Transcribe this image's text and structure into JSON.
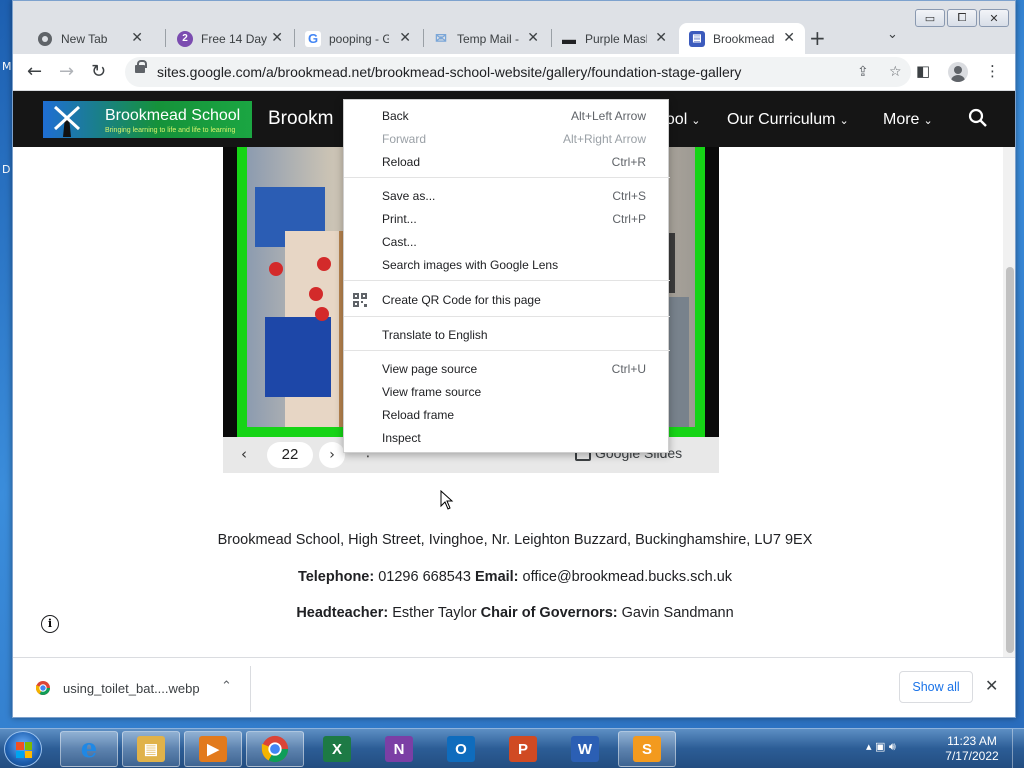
{
  "desktop": {
    "glyphs": [
      "M",
      "D"
    ]
  },
  "window": {
    "controls": [
      "▭",
      "⧠",
      "✕"
    ]
  },
  "tabs": [
    {
      "label": "New Tab",
      "icon": "chrome-icon",
      "color": "#5f6368",
      "glyph": ""
    },
    {
      "label": "Free 14 Day",
      "icon": "numeric-two-icon",
      "color": "#7b4cb0",
      "glyph": "2"
    },
    {
      "label": "pooping - Go",
      "icon": "google-icon",
      "color": "#4285f4",
      "glyph": "G"
    },
    {
      "label": "Temp Mail -",
      "icon": "mail-icon",
      "color": "#7aa6d8",
      "glyph": "✉"
    },
    {
      "label": "Purple Mash",
      "icon": "purple-mash-icon",
      "color": "#202124",
      "glyph": "▬"
    },
    {
      "label": "Brookmead",
      "icon": "google-sites-icon",
      "color": "#3c5bbd",
      "glyph": "▤"
    }
  ],
  "toolbar": {
    "url": "sites.google.com/a/brookmead.net/brookmead-school-website/gallery/foundation-stage-gallery"
  },
  "site": {
    "logo_name": "Brookmead School",
    "logo_tagline": "Bringing learning to life and life to learning",
    "title": "Brookm",
    "nav": [
      "hool",
      "Our Curriculum",
      "More"
    ]
  },
  "embed": {
    "page_number": "22",
    "slides_label": "Google Slides"
  },
  "footer": {
    "address": "Brookmead School, High Street, Ivinghoe, Nr. Leighton Buzzard, Buckinghamshire, LU7 9EX",
    "telephone_label": "Telephone:",
    "telephone": " 01296 668543  ",
    "email_label": "Email:",
    "email": " office@brookmead.bucks.sch.uk",
    "head_label": "Headteacher:",
    "head": " Esther Taylor  ",
    "chair_label": "Chair of Governors:",
    "chair": " Gavin Sandmann"
  },
  "context_menu": {
    "items": [
      {
        "label": "Back",
        "shortcut": "Alt+Left Arrow",
        "disabled": false
      },
      {
        "label": "Forward",
        "shortcut": "Alt+Right Arrow",
        "disabled": true
      },
      {
        "label": "Reload",
        "shortcut": "Ctrl+R",
        "disabled": false
      },
      {
        "label": "Save as...",
        "shortcut": "Ctrl+S",
        "disabled": false
      },
      {
        "label": "Print...",
        "shortcut": "Ctrl+P",
        "disabled": false
      },
      {
        "label": "Cast...",
        "shortcut": "",
        "disabled": false
      },
      {
        "label": "Search images with Google Lens",
        "shortcut": "",
        "disabled": false
      },
      {
        "label": "Create QR Code for this page",
        "shortcut": "",
        "disabled": false
      },
      {
        "label": "Translate to English",
        "shortcut": "",
        "disabled": false
      },
      {
        "label": "View page source",
        "shortcut": "Ctrl+U",
        "disabled": false
      },
      {
        "label": "View frame source",
        "shortcut": "",
        "disabled": false
      },
      {
        "label": "Reload frame",
        "shortcut": "",
        "disabled": false
      },
      {
        "label": "Inspect",
        "shortcut": "",
        "disabled": false
      }
    ]
  },
  "download": {
    "filename": "using_toilet_bat....webp",
    "show_all": "Show all"
  },
  "taskbar": {
    "apps": [
      {
        "name": "internet-explorer",
        "glyph": "e",
        "color": "#1f88e5",
        "active": true
      },
      {
        "name": "file-explorer",
        "glyph": "▤",
        "color": "#e0b24a",
        "active": true
      },
      {
        "name": "media-player",
        "glyph": "▶",
        "color": "#e27a1c",
        "active": true
      },
      {
        "name": "chrome",
        "glyph": "",
        "color": "#ffffff",
        "active": true
      },
      {
        "name": "excel",
        "glyph": "X",
        "color": "#1d7a45",
        "active": false
      },
      {
        "name": "onenote",
        "glyph": "N",
        "color": "#7b3fa5",
        "active": false
      },
      {
        "name": "outlook",
        "glyph": "O",
        "color": "#0f6cbd",
        "active": false
      },
      {
        "name": "powerpoint",
        "glyph": "P",
        "color": "#d04a23",
        "active": false
      },
      {
        "name": "word",
        "glyph": "W",
        "color": "#2b5fb4",
        "active": false
      },
      {
        "name": "sublime-text",
        "glyph": "S",
        "color": "#f39a1e",
        "active": true
      }
    ],
    "time": "11:23 AM",
    "date": "7/17/2022"
  }
}
